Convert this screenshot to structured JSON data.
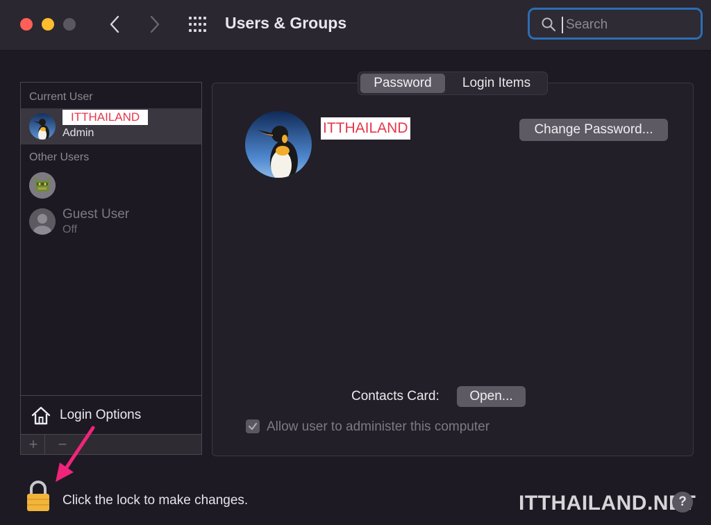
{
  "window": {
    "title": "Users & Groups"
  },
  "search": {
    "placeholder": "Search",
    "value": ""
  },
  "sidebar": {
    "current_user_label": "Current User",
    "other_users_label": "Other Users",
    "current_user": {
      "name": "ITTHAILAND",
      "role": "Admin"
    },
    "other_users": [
      {
        "name": "",
        "status": ""
      },
      {
        "name": "Guest User",
        "status": "Off"
      }
    ],
    "login_options_label": "Login Options",
    "add_label": "+",
    "remove_label": "−"
  },
  "tabs": [
    {
      "label": "Password",
      "selected": true
    },
    {
      "label": "Login Items",
      "selected": false
    }
  ],
  "main": {
    "user_name": "ITTHAILAND",
    "change_password_label": "Change Password...",
    "contacts_card_label": "Contacts Card:",
    "open_label": "Open...",
    "allow_admin_label": "Allow user to administer this computer",
    "allow_admin_checked": true
  },
  "footer": {
    "lock_text": "Click the lock to make changes.",
    "watermark": "ITTHAILAND.NET",
    "help_label": "?"
  },
  "colors": {
    "background": "#1d1a24",
    "search_focus": "#2b6eb5",
    "name_highlight_text": "#e8354a",
    "arrow": "#f0247a",
    "lock": "#f2b53a"
  },
  "icons": [
    "chevron-left-icon",
    "chevron-right-icon",
    "grid-icon",
    "search-icon",
    "house-icon",
    "lock-icon",
    "checkmark-icon",
    "arrow-icon"
  ]
}
